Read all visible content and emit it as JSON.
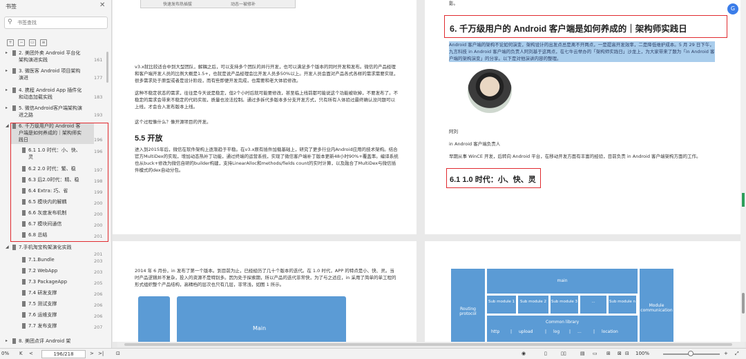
{
  "sidebar": {
    "title": "书签",
    "close": "✕",
    "search_placeholder": "书签查找",
    "toc": [
      {
        "label": "2. 美团外卖 Android 平台化架构演进实践",
        "page": "161",
        "level": 1
      },
      {
        "label": "3. 微医客 Android 项目架构演进",
        "page": "177",
        "level": 1
      },
      {
        "label": "4. 携程 Android App 插件化和动态加载实践",
        "page": "183",
        "level": 1
      },
      {
        "label": "5. 微信Android客户端架构演进之路",
        "page": "193",
        "level": 1
      },
      {
        "label": "6. 千万级用户的 Android 客户端是如何养成的｜架构师实践日",
        "page": "196",
        "level": 1
      },
      {
        "label": "6.1 1.0 时代：小、快、灵",
        "page": "196",
        "level": 2
      },
      {
        "label": "6.2 2.0 时代：繁、稳",
        "page": "197",
        "level": 2
      },
      {
        "label": "6.3 后2.0时代：精、稳",
        "page": "198",
        "level": 2
      },
      {
        "label": "6.4 Extra: 巧、省",
        "page": "199",
        "level": 2
      },
      {
        "label": "6.5 模块内的解耦",
        "page": "200",
        "level": 2
      },
      {
        "label": "6.6 灰度发布机制",
        "page": "200",
        "level": 2
      },
      {
        "label": "6.7 模块间通信",
        "page": "200",
        "level": 2
      },
      {
        "label": "6.8 总结",
        "page": "201",
        "level": 2
      },
      {
        "label": "7.手机淘宝构架演化实践",
        "page": "201",
        "level": 1
      },
      {
        "label": "7.1.Bundle",
        "page": "203",
        "level": 2
      },
      {
        "label": "7.2 WebApp",
        "page": "203",
        "level": 2
      },
      {
        "label": "7.3 PackageApp",
        "page": "205",
        "level": 2
      },
      {
        "label": "7.4 研发支撑",
        "page": "206",
        "level": 2
      },
      {
        "label": "7.5 测试支撑",
        "page": "206",
        "level": 2
      },
      {
        "label": "7.6 运维支撑",
        "page": "206",
        "level": 2
      },
      {
        "label": "7.7 发布支撑",
        "page": "207",
        "level": 2
      },
      {
        "label": "8. 美团点评 Android 架",
        "page": "",
        "level": 1
      }
    ]
  },
  "left_page_top": {
    "diagram_labels": [
      "快速发布热插拔",
      "动态一被修补"
    ],
    "para1": "v3.x就比较适合中到大型团队，解耦之后，可以支持多个团队的并行开发，也可以满足多个版本的同时开发和发布。微信的产品经理和客户端开发人员的比例大概是1.5+，也就是说产品经理会比开发人员多50%以上。开发人员会面对产品各式各样的需求需要实现，很多需求处于原型或者是设计阶段，而有些即便开发完成，也需要和老大体验修改。",
    "para2": "这种不稳定状态的需求，往往是今天说是稳定，但2个小时后就可能要修改，甚至临上线前都可能说这个功能被砍掉，不要发布了。不稳定的需求会带来不稳定的代码实现，质量也没法控制。通过多拆代多版本多分支开发方式，只有所有人体验过最终确认没问题可以上线，才会合入发布版本上线。",
    "para3": "这个过程像什么？像开源项目的开发。",
    "heading": "5.5 开放",
    "para4": "进入到2015年后，微信在软件架构上逐渐趋于平稳。在v3.x原有插件加载基础上，研究了更多行业内Android应用的技术架构。结合官方MultiDex的实现，增加动态热补丁功能，通过终端的运营系统，实现了微信客户端补丁版本更新48小时90%+覆盖率。编译系统也从buck+修改为微信自研的builder构建，支持LinearAlloc和methods/fields count的实时计算，以及融合了MultiDex与微信插件模式的dex自动分包。"
  },
  "right_page_top": {
    "intro_end": "影。",
    "heading": "6. 千万级用户的 Android 客户端是如何养成的｜架构师实践日",
    "selected": "Android 客户端的架构不论如何演变，架构设计的出发点总是离不开两点，一是提高开发效率，二是降低维护成本。5 月 29 日下午，九言科技 in Android 客户端的负责人阿刘基于这两点，在七牛云举办的「架构师实践日」沙龙上，为大家带来了题为「in Android 客户端的架构演变」的分享。以下是对他演讲内容的整理。",
    "author_name": "阿刘",
    "author_role": "in Android 客户端负责人",
    "author_bio": "早期从事 WinCE 开发，后转向 Android 平台，在移动开发方面有丰富的经验，目前负责 in Android 客户端架构方面的工作。",
    "subheading": "6.1 1.0 时代：小、快、灵"
  },
  "left_page_bottom": {
    "para": "2014 年 6 月份，in 发布了第一个版本。到目前为止，已经经历了几十个版本的迭代。在 1.0 时代，APP 的特点是小、快、灵。当时产品逻辑并不复杂，投入的资源不是特别多。因为处于探索期，所以产品的迭代非常快，为了与之适应，in 采用了简单的单工程的形式组织整个产品结构，高精档的层次也只有几层，非常浅，如图 1 所示。",
    "main_box": "Main"
  },
  "right_page_bottom": {
    "routing": "Routing protocol",
    "main": "main",
    "subs": [
      "Sub module 1",
      "Sub module 2",
      "Sub module 3",
      "...",
      "Sub module n"
    ],
    "module_comm": "Module communication",
    "common_lib": "Common library",
    "libs": [
      "http",
      "|",
      "upload",
      "|",
      "log",
      "|",
      "...",
      "|",
      "location"
    ]
  },
  "statusbar": {
    "zoom_left": "0%",
    "page": "196/218",
    "zoom": "100%",
    "first": "K",
    "prev": "<",
    "next": ">",
    "last": ">|"
  },
  "colors": {
    "highlight_red": "#e0292e",
    "selection_blue": "#a9cdec",
    "diagram_blue": "#5b9bd5",
    "fab": "#3b7de9"
  }
}
